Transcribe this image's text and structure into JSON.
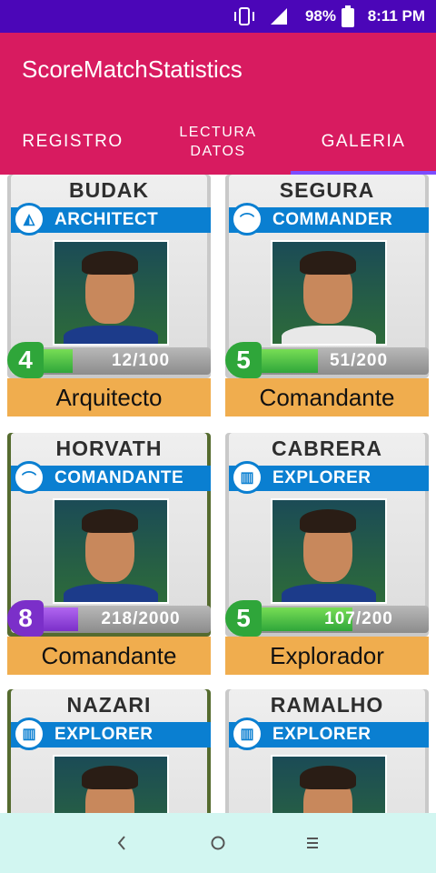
{
  "status_bar": {
    "battery_percent": "98%",
    "time": "8:11 PM"
  },
  "app_bar": {
    "title": "ScoreMatchStatistics"
  },
  "tabs": [
    {
      "label": "REGISTRO"
    },
    {
      "label": "LECTURA DATOS"
    },
    {
      "label": "GALERIA"
    }
  ],
  "cards": [
    {
      "name": "BUDAK",
      "role": "ARCHITECT",
      "level": "4",
      "xp": "12/100",
      "label": "Arquitecto"
    },
    {
      "name": "SEGURA",
      "role": "COMMANDER",
      "level": "5",
      "xp": "51/200",
      "label": "Comandante"
    },
    {
      "name": "HORVATH",
      "role": "COMANDANTE",
      "level": "8",
      "xp": "218/2000",
      "label": "Comandante"
    },
    {
      "name": "CABRERA",
      "role": "EXPLORER",
      "level": "5",
      "xp": "107/200",
      "label": "Explorador"
    },
    {
      "name": "NAZARI",
      "role": "EXPLORER",
      "level": "",
      "xp": "",
      "label": ""
    },
    {
      "name": "RAMALHO",
      "role": "EXPLORER",
      "level": "",
      "xp": "",
      "label": ""
    }
  ],
  "nav": {
    "back_icon": "chevron-left-icon",
    "home_icon": "circle-home-icon",
    "recents_icon": "menu-lines-icon"
  },
  "colors": {
    "status_bar": "#4b06b8",
    "app_bar": "#d81b60",
    "tab_indicator": "#7c4dff",
    "card_label": "#f0ad4e",
    "role_band": "#0a7fd1",
    "nav_bar": "#d2f6f1"
  }
}
